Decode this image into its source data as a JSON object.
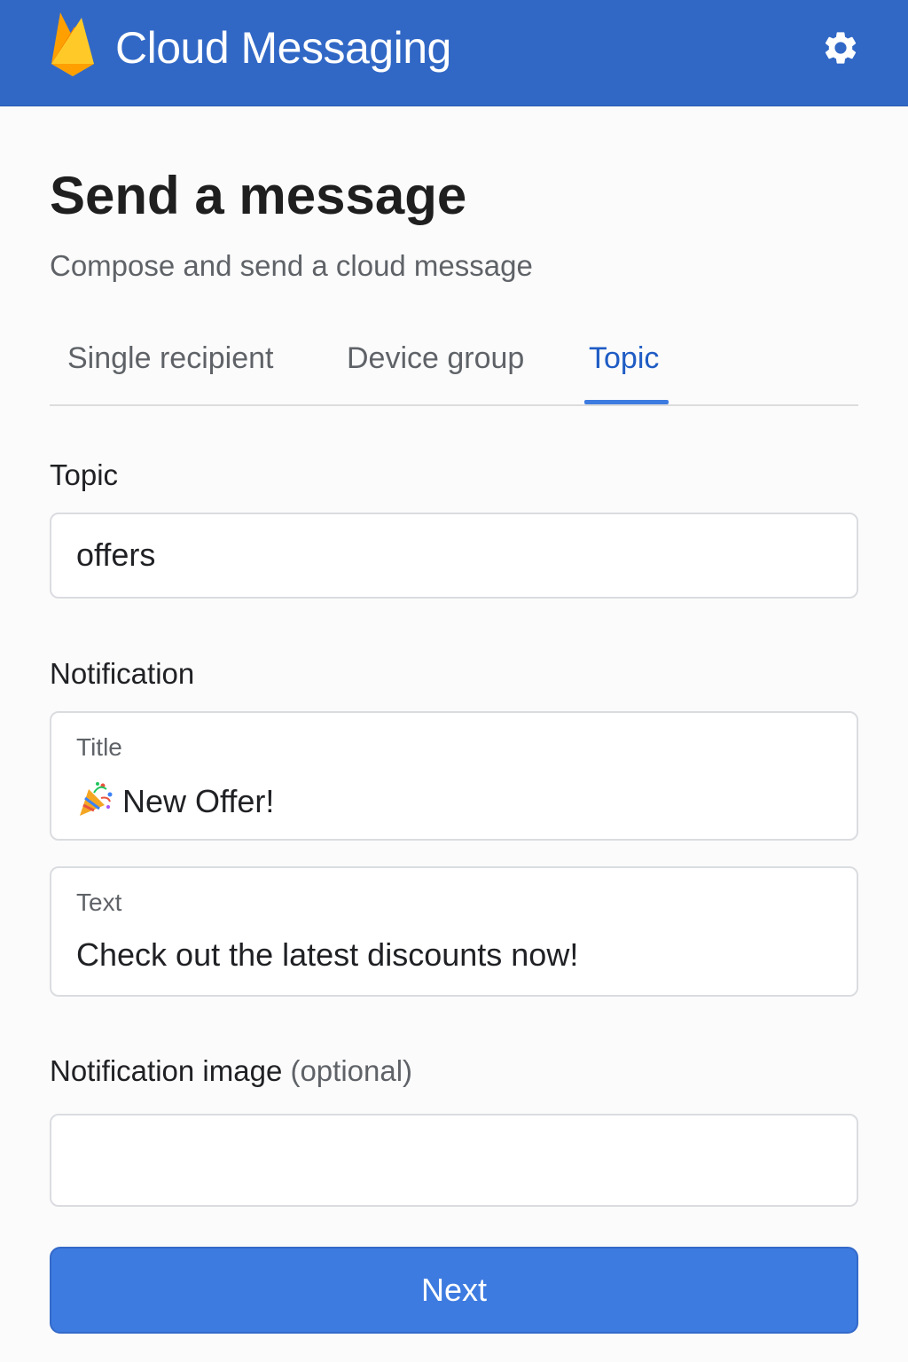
{
  "app_bar": {
    "title": "Cloud Messaging",
    "logo_icon": "firebase-flame-icon",
    "settings_icon": "gear-icon",
    "background_color": "#3168c6"
  },
  "page": {
    "title": "Send a message",
    "subtitle": "Compose and send a cloud message"
  },
  "tabs": [
    {
      "label": "Single recipient",
      "active": false
    },
    {
      "label": "Device group",
      "active": false
    },
    {
      "label": "Topic",
      "active": true
    }
  ],
  "topic": {
    "label": "Topic",
    "value": "offers"
  },
  "notification": {
    "label": "Notification",
    "title_field": {
      "caption": "Title",
      "emoji_icon": "party-popper-icon",
      "value": "New Offer!"
    },
    "text_field": {
      "caption": "Text",
      "value": "Check out the latest discounts now!"
    }
  },
  "notification_image": {
    "label": "Notification image",
    "optional_label": "(optional)",
    "value": ""
  },
  "next_button": {
    "label": "Next",
    "color": "#3d7be0"
  },
  "colors": {
    "accent": "#1f5cc4",
    "tab_indicator": "#3d7be0"
  }
}
